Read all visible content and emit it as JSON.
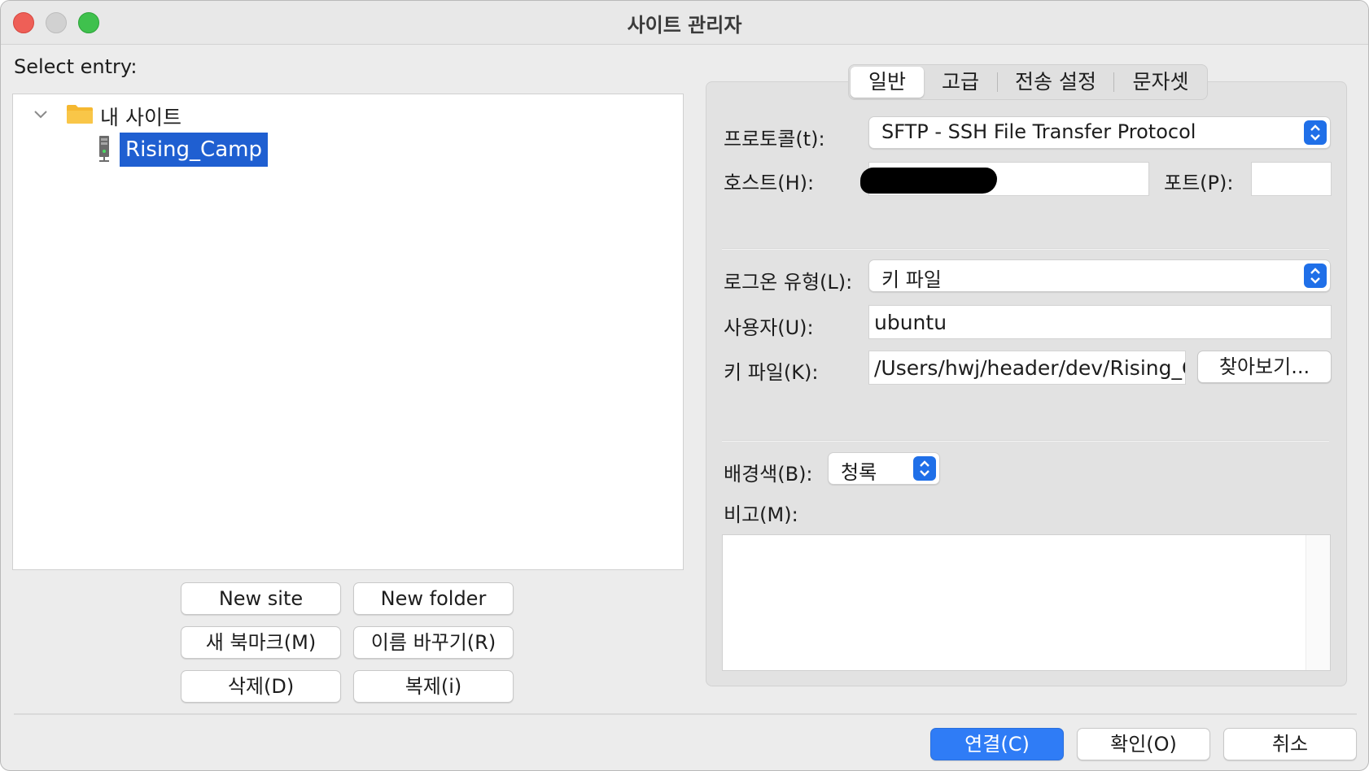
{
  "window": {
    "title": "사이트 관리자"
  },
  "left": {
    "select_entry_label": "Select entry:",
    "tree": {
      "root_label": "내 사이트",
      "selected_site": "Rising_Camp"
    },
    "buttons": {
      "new_site": "New site",
      "new_folder": "New folder",
      "new_bookmark": "새 북마크(M)",
      "rename": "이름 바꾸기(R)",
      "delete": "삭제(D)",
      "duplicate": "복제(i)"
    }
  },
  "tabs": [
    "일반",
    "고급",
    "전송 설정",
    "문자셋"
  ],
  "general": {
    "protocol_label": "프로토콜(t):",
    "protocol_value": "SFTP - SSH File Transfer Protocol",
    "host_label": "호스트(H):",
    "host_value": "",
    "port_label": "포트(P):",
    "port_value": "",
    "logon_type_label": "로그온 유형(L):",
    "logon_type_value": "키 파일",
    "user_label": "사용자(U):",
    "user_value": "ubuntu",
    "key_file_label": "키 파일(K):",
    "key_file_value": "/Users/hwj/header/dev/Rising_C",
    "browse_button": "찾아보기...",
    "bg_color_label": "배경색(B):",
    "bg_color_value": "청록",
    "comments_label": "비고(M):",
    "comments_value": ""
  },
  "footer": {
    "connect": "연결(C)",
    "ok": "확인(O)",
    "cancel": "취소"
  },
  "colors": {
    "accent": "#2f7cf6",
    "selection": "#1f5fd1",
    "folder": "#f5b830"
  },
  "icons": {
    "chevron": "chevron-down-icon",
    "folder": "folder-icon",
    "server": "server-icon"
  }
}
